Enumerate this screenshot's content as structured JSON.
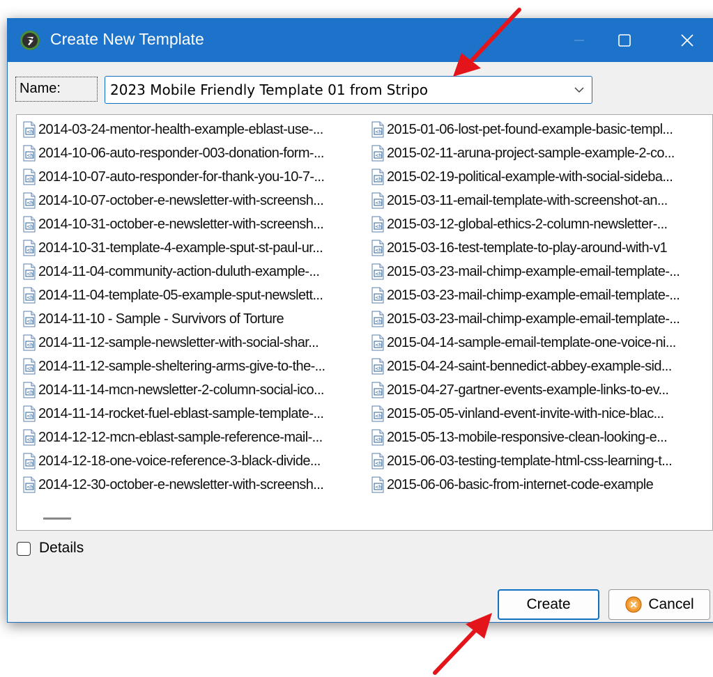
{
  "window": {
    "title": "Create New Template",
    "colors": {
      "titlebar": "#1c73c9",
      "accent": "#0f6fc0",
      "annotation_arrow": "#e3151a"
    }
  },
  "form": {
    "name_label": "Name:",
    "name_value": "2023 Mobile Friendly Template 01 from Stripo"
  },
  "templates": {
    "left_column": [
      "2014-03-24-mentor-health-example-eblast-use-...",
      "2014-10-06-auto-responder-003-donation-form-...",
      "2014-10-07-auto-responder-for-thank-you-10-7-...",
      "2014-10-07-october-e-newsletter-with-screensh...",
      "2014-10-31-october-e-newsletter-with-screensh...",
      "2014-10-31-template-4-example-sput-st-paul-ur...",
      "2014-11-04-community-action-duluth-example-...",
      "2014-11-04-template-05-example-sput-newslett...",
      "2014-11-10 - Sample - Survivors of Torture",
      "2014-11-12-sample-newsletter-with-social-shar...",
      "2014-11-12-sample-sheltering-arms-give-to-the-...",
      "2014-11-14-mcn-newsletter-2-column-social-ico...",
      "2014-11-14-rocket-fuel-eblast-sample-template-...",
      "2014-12-12-mcn-eblast-sample-reference-mail-...",
      "2014-12-18-one-voice-reference-3-black-divide...",
      "2014-12-30-october-e-newsletter-with-screensh..."
    ],
    "right_column": [
      "2015-01-06-lost-pet-found-example-basic-templ...",
      "2015-02-11-aruna-project-sample-example-2-co...",
      "2015-02-19-political-example-with-social-sideba...",
      "2015-03-11-email-template-with-screenshot-an...",
      "2015-03-12-global-ethics-2-column-newsletter-...",
      "2015-03-16-test-template-to-play-around-with-v1",
      "2015-03-23-mail-chimp-example-email-template-...",
      "2015-03-23-mail-chimp-example-email-template-...",
      "2015-03-23-mail-chimp-example-email-template-...",
      "2015-04-14-sample-email-template-one-voice-ni...",
      "2015-04-24-saint-bennedict-abbey-example-sid...",
      "2015-04-27-gartner-events-example-links-to-ev...",
      "2015-05-05-vinland-event-invite-with-nice-blac...",
      "2015-05-13-mobile-responsive-clean-looking-e...",
      "2015-06-03-testing-template-html-css-learning-t...",
      "2015-06-06-basic-from-internet-code-example"
    ],
    "item_icon": "html-file-icon"
  },
  "details": {
    "label": "Details",
    "checked": false
  },
  "buttons": {
    "create": "Create",
    "cancel": "Cancel"
  }
}
